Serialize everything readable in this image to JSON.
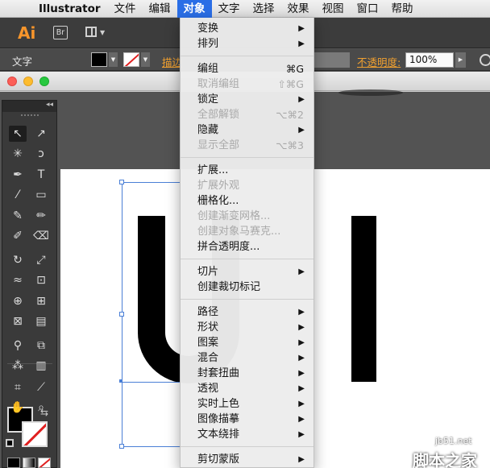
{
  "menubar": {
    "app_name": "Illustrator",
    "items": [
      "文件",
      "编辑",
      "对象",
      "文字",
      "选择",
      "效果",
      "视图",
      "窗口",
      "帮助"
    ],
    "active": "对象"
  },
  "appbar": {
    "logo": "Ai",
    "bridge": "Br"
  },
  "control_bar": {
    "type_label": "文字",
    "stroke_link": "描边",
    "opacity_label": "不透明度:",
    "opacity_value": "100%"
  },
  "object_menu": [
    [
      {
        "label": "变换",
        "submenu": true
      },
      {
        "label": "排列",
        "submenu": true
      }
    ],
    [
      {
        "label": "编组",
        "shortcut": "⌘G"
      },
      {
        "label": "取消编组",
        "shortcut": "⇧⌘G",
        "disabled": true
      },
      {
        "label": "锁定",
        "submenu": true
      },
      {
        "label": "全部解锁",
        "shortcut": "⌥⌘2",
        "disabled": true
      },
      {
        "label": "隐藏",
        "submenu": true
      },
      {
        "label": "显示全部",
        "shortcut": "⌥⌘3",
        "disabled": true
      }
    ],
    [
      {
        "label": "扩展..."
      },
      {
        "label": "扩展外观",
        "disabled": true
      },
      {
        "label": "栅格化..."
      },
      {
        "label": "创建渐变网格...",
        "disabled": true
      },
      {
        "label": "创建对象马赛克...",
        "disabled": true
      },
      {
        "label": "拼合透明度..."
      }
    ],
    [
      {
        "label": "切片",
        "submenu": true
      },
      {
        "label": "创建裁切标记"
      }
    ],
    [
      {
        "label": "路径",
        "submenu": true
      },
      {
        "label": "形状",
        "submenu": true
      },
      {
        "label": "图案",
        "submenu": true
      },
      {
        "label": "混合",
        "submenu": true
      },
      {
        "label": "封套扭曲",
        "submenu": true
      },
      {
        "label": "透视",
        "submenu": true
      },
      {
        "label": "实时上色",
        "submenu": true
      },
      {
        "label": "图像描摹",
        "submenu": true
      },
      {
        "label": "文本绕排",
        "submenu": true
      }
    ],
    [
      {
        "label": "剪切蒙版",
        "submenu": true
      }
    ]
  ],
  "tools": [
    [
      "selection-tool",
      "↖"
    ],
    [
      "direct-selection-tool",
      "↗"
    ],
    [
      "magic-wand-tool",
      "✳"
    ],
    [
      "lasso-tool",
      "ↄ"
    ],
    [
      "pen-tool",
      "✒"
    ],
    [
      "type-tool",
      "T"
    ],
    [
      "line-tool",
      "⁄"
    ],
    [
      "rectangle-tool",
      "▭"
    ],
    [
      "paintbrush-tool",
      "✎"
    ],
    [
      "pencil-tool",
      "✏"
    ],
    [
      "blob-brush-tool",
      "✐"
    ],
    [
      "eraser-tool",
      "⌫"
    ],
    [
      "rotate-tool",
      "↻"
    ],
    [
      "scale-tool",
      "⤢"
    ],
    [
      "width-tool",
      "≈"
    ],
    [
      "free-transform-tool",
      "⊡"
    ],
    [
      "shape-builder-tool",
      "⊕"
    ],
    [
      "perspective-grid-tool",
      "⊞"
    ],
    [
      "mesh-tool",
      "⊠"
    ],
    [
      "gradient-tool",
      "▤"
    ],
    [
      "eyedropper-tool",
      "⚲"
    ],
    [
      "blend-tool",
      "⧉"
    ],
    [
      "symbol-sprayer-tool",
      "⁂"
    ],
    [
      "column-graph-tool",
      "▥"
    ],
    [
      "artboard-tool",
      "⌗"
    ],
    [
      "slice-tool",
      "⟋"
    ],
    [
      "hand-tool",
      "✋"
    ],
    [
      "zoom-tool",
      "⌕"
    ]
  ],
  "watermark": {
    "url": "jb51.net",
    "brand": "脚本之家"
  },
  "colors": {
    "menu_highlight": "#2a6ee6",
    "selection": "#4a7fd6",
    "stroke_none": "#e02020",
    "link_orange": "#f0a030"
  }
}
